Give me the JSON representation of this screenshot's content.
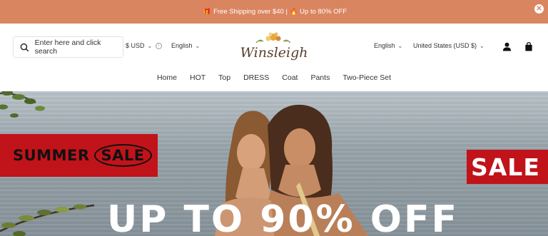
{
  "announcement": {
    "text_part1": "Free Shipping over $40 |",
    "text_part2": "Up to 80% OFF",
    "close_icon": "close-icon",
    "background": "#d98560"
  },
  "header": {
    "search_placeholder": "Enter here and click search",
    "currency": "$ USD",
    "language_left": "English",
    "brand": "Winsleigh",
    "language_right": "English",
    "region": "United States (USD $)",
    "account_icon": "user-icon",
    "cart_icon": "bag-icon"
  },
  "nav": {
    "items": [
      "Home",
      "HOT",
      "Top",
      "DRESS",
      "Coat",
      "Pants",
      "Two-Piece Set"
    ]
  },
  "hero": {
    "summer_word": "SUMMER",
    "sale_word": "SALE",
    "right_badge": "SALE",
    "headline": "UP TO 90% OFF",
    "badge_color": "#c1131a"
  }
}
